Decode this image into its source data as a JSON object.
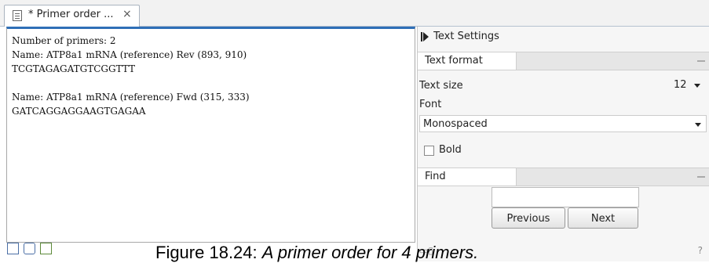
{
  "tab": {
    "title": "* Primer order ...",
    "close_glyph": "×",
    "icon": "document-icon"
  },
  "editor": {
    "text": "Number of primers: 2\nName: ATP8a1 mRNA (reference) Rev (893, 910)\nTCGTAGAGATGTCGGTTT\n\nName: ATP8a1 mRNA (reference) Fwd (315, 333)\nGATCAGGAGGAAGTGAGAA"
  },
  "side_panel": {
    "header": "Text Settings",
    "text_format": {
      "section_label": "Text format",
      "text_size_label": "Text size",
      "text_size_value": "12",
      "font_label": "Font",
      "font_value": "Monospaced",
      "bold_label": "Bold",
      "bold_checked": false
    },
    "find": {
      "section_label": "Find",
      "search_value": "",
      "previous_label": "Previous",
      "next_label": "Next"
    }
  },
  "bottom_bar": {
    "icons": [
      "text-view-icon",
      "history-icon",
      "check-document-icon"
    ],
    "help_glyph": "?"
  },
  "caption": {
    "prefix": "Figure 18.24: ",
    "text": "A primer order for 4 primers."
  }
}
